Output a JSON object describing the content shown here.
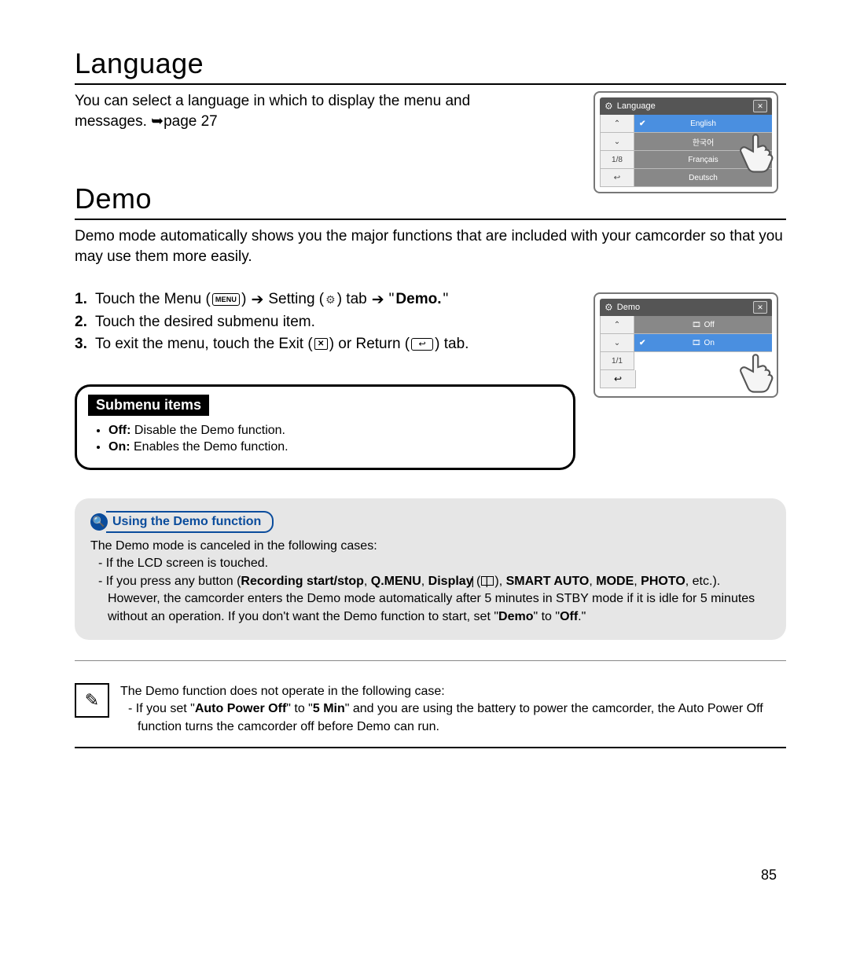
{
  "language": {
    "heading": "Language",
    "intro": "You can select a language in which to display the menu and messages. ➥page 27"
  },
  "demo": {
    "heading": "Demo",
    "intro": "Demo mode automatically shows you the major functions that are included with your camcorder so that you may use them more easily.",
    "steps": {
      "s1_a": "Touch the Menu (",
      "s1_menu": "MENU",
      "s1_b": ") ",
      "s1_c": " Setting (",
      "s1_d": ") tab ",
      "s1_e": " \"",
      "s1_demoWord": "Demo.",
      "s1_f": "\"",
      "s2": "Touch the desired submenu item.",
      "s3_a": "To exit the menu, touch the Exit (",
      "s3_b": ") or Return (",
      "s3_c": ") tab.",
      "num1": "1.",
      "num2": "2.",
      "num3": "3."
    }
  },
  "submenu": {
    "title": "Submenu items",
    "off_label": "Off:",
    "off_text": " Disable the Demo function.",
    "on_label": "On:",
    "on_text": " Enables the Demo function."
  },
  "usingDemo": {
    "title": "Using the Demo function",
    "line1": "The Demo mode is canceled in the following cases:",
    "bullet1": "-  If the LCD screen is touched.",
    "bullet2a": "-  If you press any button (",
    "b_recstart": "Recording start/stop",
    "sep": ", ",
    "b_qmenu": "Q.MENU",
    "b_display": "Display",
    "b_display_paren_open": " (",
    "b_display_paren_close": "), ",
    "b_smart": "SMART AUTO",
    "b_mode": "MODE",
    "b_photo": "PHOTO",
    "bullet2b": ", etc.). However, the camcorder enters the Demo mode automatically after 5 minutes in STBY mode if it is idle for 5 minutes without an operation. If you don't want the Demo function to start, set \"",
    "b_demo": "Demo",
    "bullet2c": "\" to \"",
    "b_off": "Off",
    "bullet2d": ".\""
  },
  "note": {
    "line1": "The Demo function does not operate in the following case:",
    "bullet_a": "-  If you set \"",
    "b_apo": "Auto Power Off",
    "bullet_b": "\" to \"",
    "b_5min": "5 Min",
    "bullet_c": "\" and you are using the battery to power the camcorder, the Auto Power Off function turns the camcorder off before Demo can run."
  },
  "lcd_lang": {
    "title": "Language",
    "pager": "1/8",
    "items": [
      "English",
      "한국어",
      "Français",
      "Deutsch"
    ]
  },
  "lcd_demo": {
    "title": "Demo",
    "pager": "1/1",
    "items": [
      "Off",
      "On"
    ]
  },
  "arrows": {
    "right": "➔"
  },
  "page_number": "85"
}
